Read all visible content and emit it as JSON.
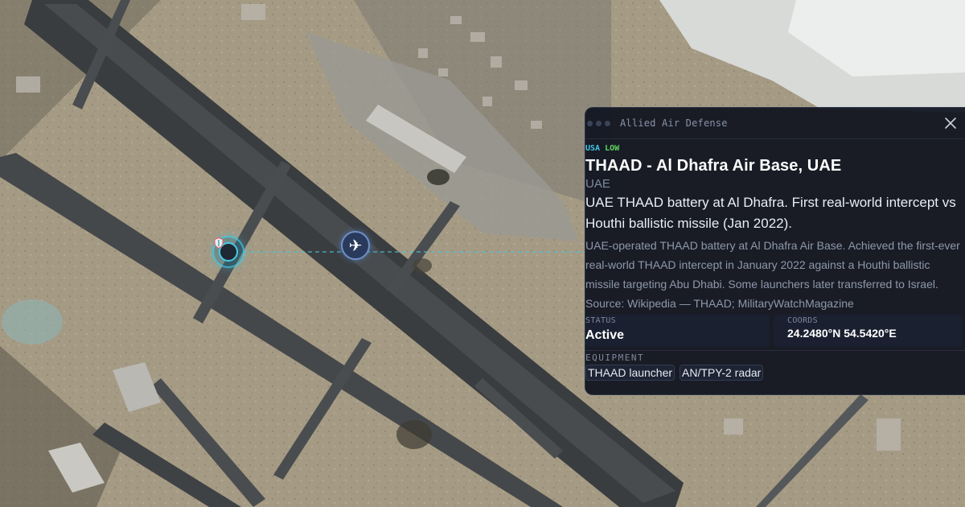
{
  "map": {
    "markers": [
      {
        "name": "air-defense-site",
        "icon": "shield-icon",
        "color": "#49c8e4"
      },
      {
        "name": "air-base",
        "icon": "airplane-icon",
        "glyph": "✈",
        "color": "#6f8fc8"
      }
    ]
  },
  "panel": {
    "title": "Allied Air Defense",
    "close_icon": "close-icon",
    "badges": {
      "country": "USA",
      "threat": "LOW",
      "country_color": "#42c6e6",
      "threat_color": "#5fd35f"
    },
    "name": "THAAD - Al Dhafra Air Base, UAE",
    "operator": "UAE",
    "summary": "UAE THAAD battery at Al Dhafra. First real-world intercept vs Houthi ballistic missile (Jan 2022).",
    "detail": "UAE-operated THAAD battery at Al Dhafra Air Base. Achieved the first-ever real-world THAAD intercept in January 2022 against a Houthi ballistic missile targeting Abu Dhabi. Some launchers later transferred to Israel. Source: Wikipedia — THAAD; MilitaryWatchMagazine",
    "status": {
      "label": "STATUS",
      "value": "Active"
    },
    "coords": {
      "label": "COORDS",
      "value": "24.2480°N 54.5420°E"
    },
    "equipment": {
      "label": "EQUIPMENT",
      "items": [
        "THAAD launcher",
        "AN/TPY-2 radar"
      ]
    }
  }
}
